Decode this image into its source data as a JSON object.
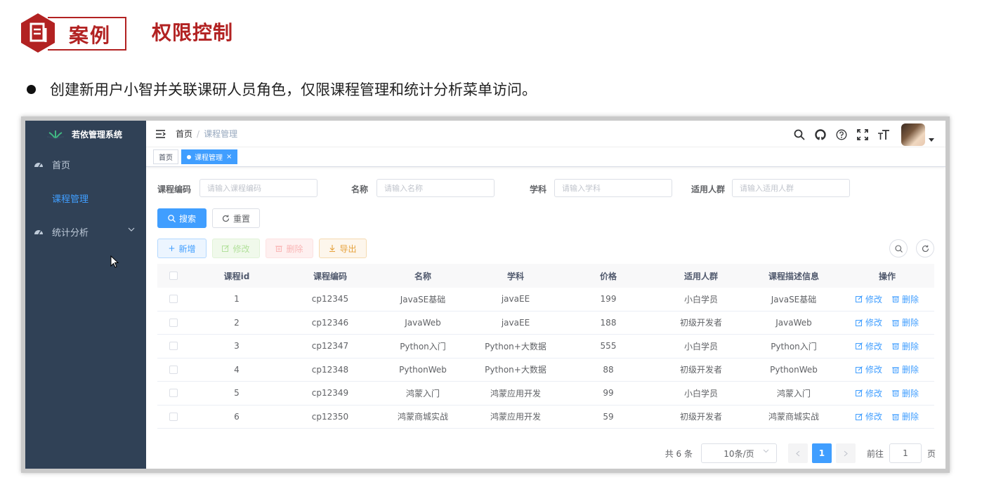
{
  "slide": {
    "badge_text": "案例",
    "title": "权限控制",
    "bullet": "创建新用户小智并关联课研人员角色，仅限课程管理和统计分析菜单访问。",
    "accent_color": "#b22222"
  },
  "app": {
    "logo_text": "若依管理系统",
    "sidebar": {
      "items": [
        {
          "label": "首页",
          "icon": "dashboard-icon"
        },
        {
          "label": "课程管理",
          "active": true
        },
        {
          "label": "统计分析",
          "icon": "dashboard-icon",
          "has_children": true
        }
      ]
    },
    "breadcrumb": {
      "home": "首页",
      "separator": "/",
      "current": "课程管理"
    },
    "navbar_icons": [
      "search-icon",
      "github-icon",
      "help-icon",
      "fullscreen-icon",
      "font-size-icon"
    ],
    "tags": [
      {
        "label": "首页",
        "active": false
      },
      {
        "label": "课程管理",
        "active": true,
        "close": "×"
      }
    ],
    "search": {
      "fields": [
        {
          "label": "课程编码",
          "placeholder": "请输入课程编码"
        },
        {
          "label": "名称",
          "placeholder": "请输入名称"
        },
        {
          "label": "学科",
          "placeholder": "请输入学科"
        },
        {
          "label": "适用人群",
          "placeholder": "请输入适用人群"
        }
      ],
      "search_button": "搜索",
      "reset_button": "重置"
    },
    "toolbar": {
      "add": "新增",
      "edit": "修改",
      "delete": "删除",
      "export": "导出"
    },
    "table": {
      "columns": [
        "课程id",
        "课程编码",
        "名称",
        "学科",
        "价格",
        "适用人群",
        "课程描述信息",
        "操作"
      ],
      "rows": [
        {
          "id": "1",
          "code": "cp12345",
          "name": "JavaSE基础",
          "subject": "javaEE",
          "price": "199",
          "audience": "小白学员",
          "desc": "JavaSE基础"
        },
        {
          "id": "2",
          "code": "cp12346",
          "name": "JavaWeb",
          "subject": "javaEE",
          "price": "188",
          "audience": "初级开发者",
          "desc": "JavaWeb"
        },
        {
          "id": "3",
          "code": "cp12347",
          "name": "Python入门",
          "subject": "Python+大数据",
          "price": "555",
          "audience": "小白学员",
          "desc": "Python入门"
        },
        {
          "id": "4",
          "code": "cp12348",
          "name": "PythonWeb",
          "subject": "Python+大数据",
          "price": "88",
          "audience": "初级开发者",
          "desc": "PythonWeb"
        },
        {
          "id": "5",
          "code": "cp12349",
          "name": "鸿蒙入门",
          "subject": "鸿蒙应用开发",
          "price": "99",
          "audience": "小白学员",
          "desc": "鸿蒙入门"
        },
        {
          "id": "6",
          "code": "cp12350",
          "name": "鸿蒙商城实战",
          "subject": "鸿蒙应用开发",
          "price": "59",
          "audience": "初级开发者",
          "desc": "鸿蒙商城实战"
        }
      ],
      "row_edit": "修改",
      "row_delete": "删除"
    },
    "pagination": {
      "total": "共 6 条",
      "page_size": "10条/页",
      "current_page": "1",
      "goto_label": "前往",
      "goto_value": "1",
      "page_suffix": "页"
    }
  }
}
